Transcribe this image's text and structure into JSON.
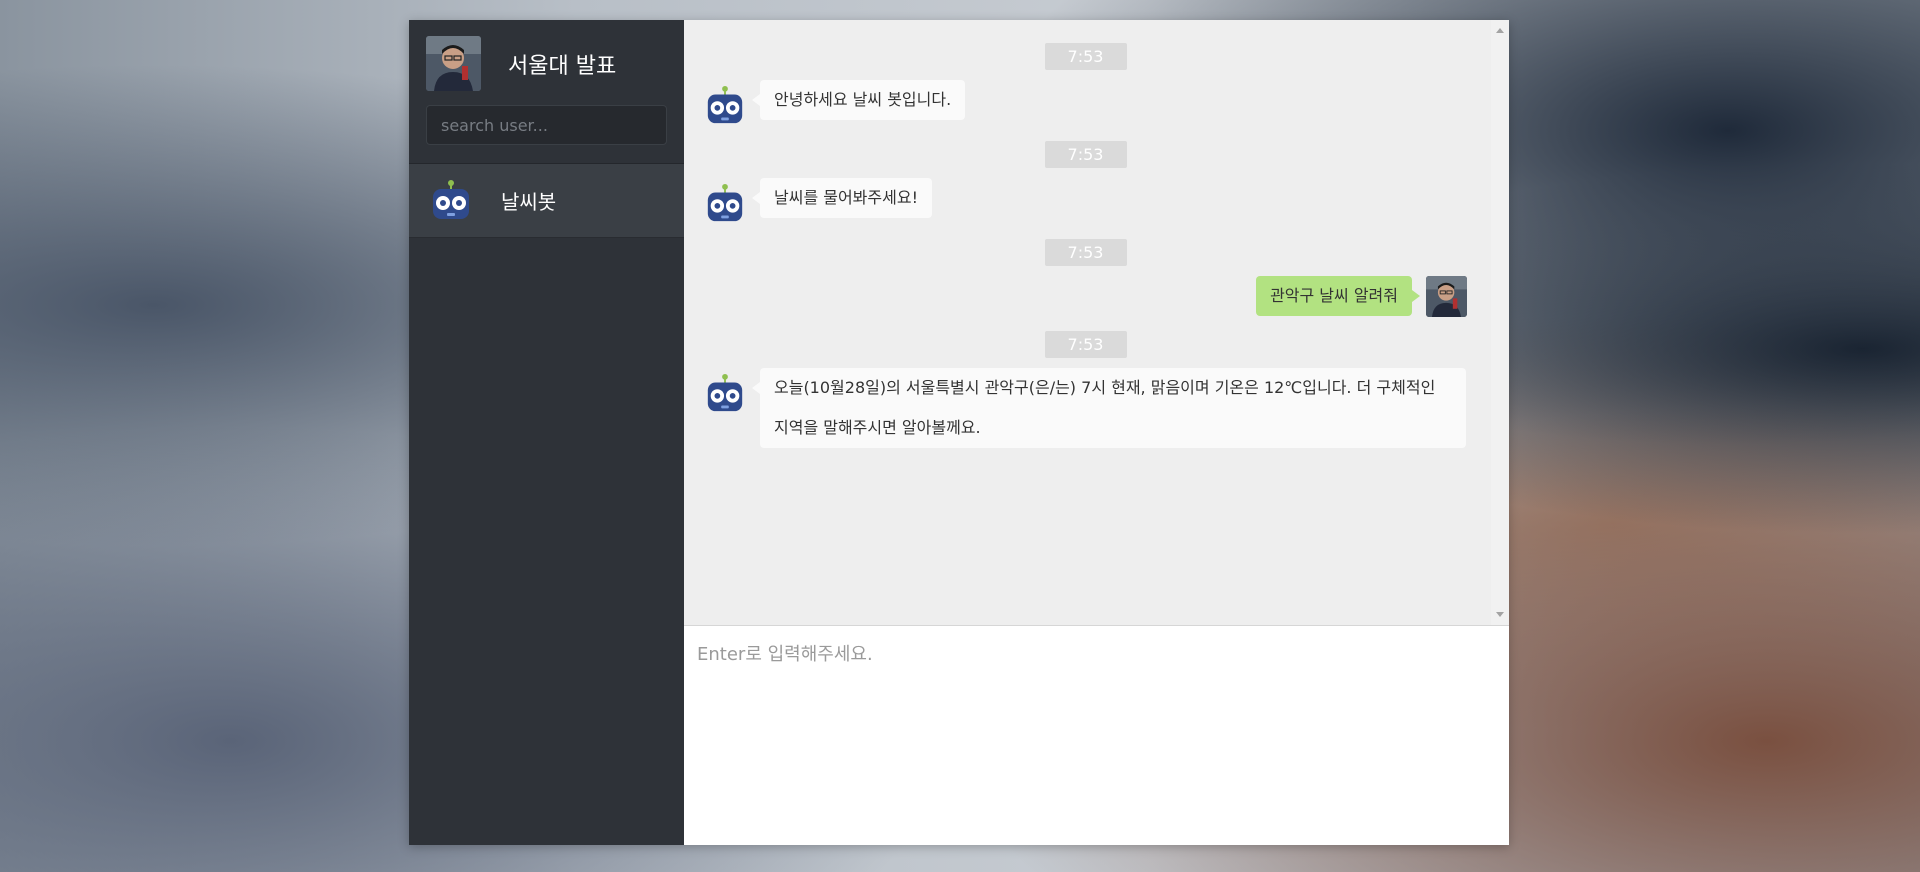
{
  "profile": {
    "name": "서울대 발표",
    "avatar_icon": "person-photo-avatar"
  },
  "search": {
    "placeholder": "search user..."
  },
  "users": [
    {
      "name": "날씨봇",
      "avatar_icon": "robot-icon"
    }
  ],
  "messages": [
    {
      "time": "7:53",
      "from": "bot",
      "text": "안녕하세요 날씨 봇입니다."
    },
    {
      "time": "7:53",
      "from": "bot",
      "text": "날씨를 물어봐주세요!"
    },
    {
      "time": "7:53",
      "from": "self",
      "text": "관악구 날씨 알려줘"
    },
    {
      "time": "7:53",
      "from": "bot",
      "text": "오늘(10월28일)의 서울특별시 관악구(은/는) 7시 현재, 맑음이며 기온은 12℃입니다. 더 구체적인 지역을 말해주시면 알아볼께요."
    }
  ],
  "composer": {
    "placeholder": "Enter로 입력해주세요."
  },
  "colors": {
    "sidebar_bg": "#2e3238",
    "selected_user_bg": "#3a3f45",
    "chat_bg": "#eeeeee",
    "self_bubble": "#b2e281",
    "bot_bubble": "#fafafa",
    "time_badge": "#dadada"
  }
}
